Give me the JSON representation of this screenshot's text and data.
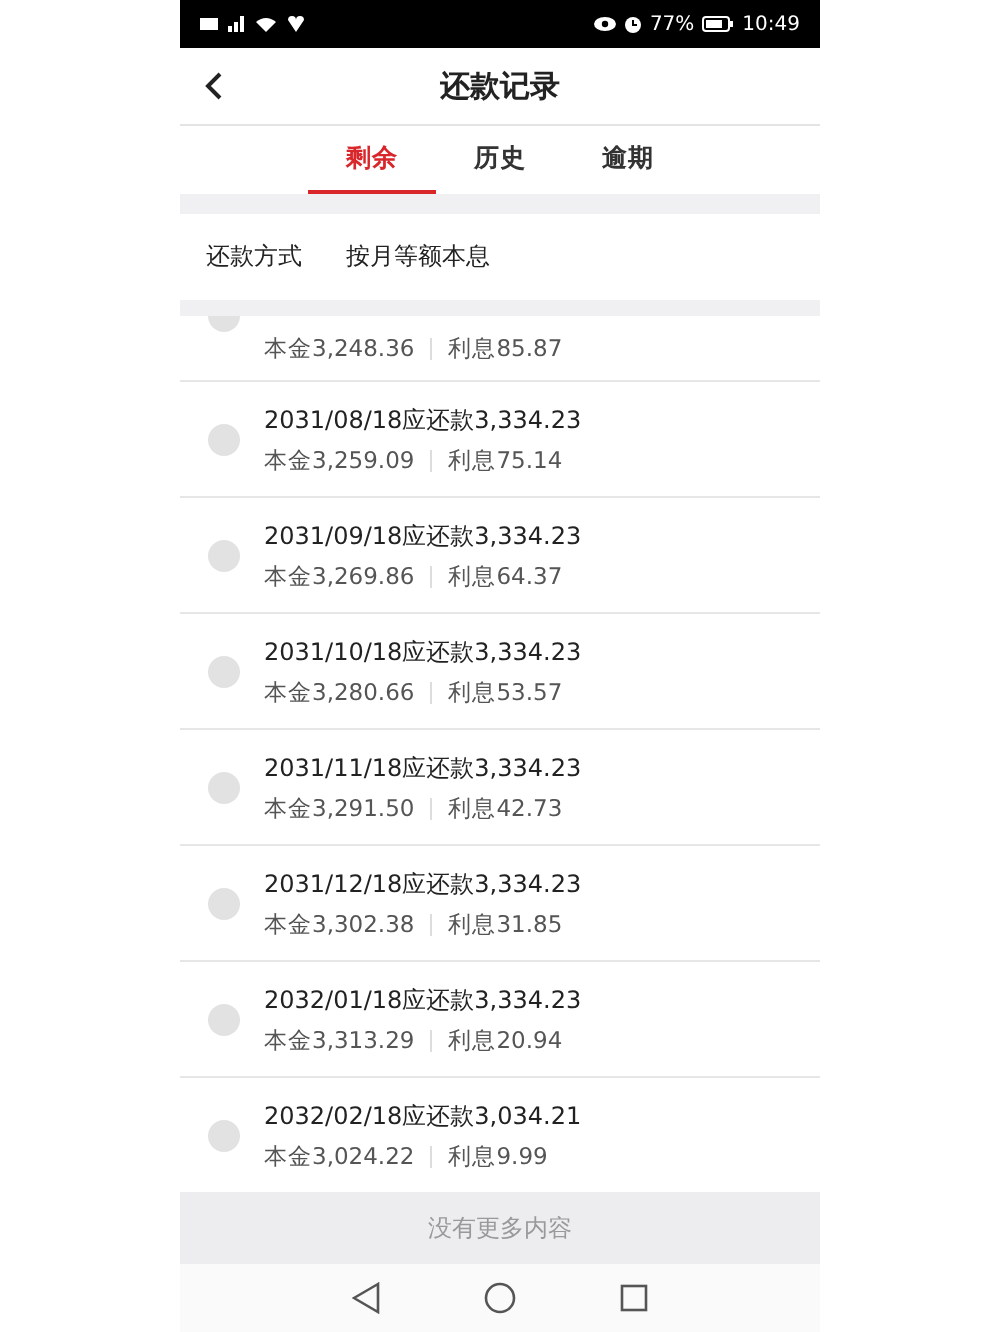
{
  "status_bar": {
    "battery": "77%",
    "time": "10:49"
  },
  "header": {
    "title": "还款记录"
  },
  "tabs": [
    {
      "label": "剩余",
      "selected": true
    },
    {
      "label": "历史",
      "selected": false
    },
    {
      "label": "逾期",
      "selected": false
    }
  ],
  "repayment_method": {
    "label": "还款方式",
    "value": "按月等额本息"
  },
  "installments": [
    {
      "principal": "本金3,248.36",
      "interest": "利息85.87"
    },
    {
      "title": "2031/08/18应还款3,334.23",
      "principal": "本金3,259.09",
      "interest": "利息75.14"
    },
    {
      "title": "2031/09/18应还款3,334.23",
      "principal": "本金3,269.86",
      "interest": "利息64.37"
    },
    {
      "title": "2031/10/18应还款3,334.23",
      "principal": "本金3,280.66",
      "interest": "利息53.57"
    },
    {
      "title": "2031/11/18应还款3,334.23",
      "principal": "本金3,291.50",
      "interest": "利息42.73"
    },
    {
      "title": "2031/12/18应还款3,334.23",
      "principal": "本金3,302.38",
      "interest": "利息31.85"
    },
    {
      "title": "2032/01/18应还款3,334.23",
      "principal": "本金3,313.29",
      "interest": "利息20.94"
    },
    {
      "title": "2032/02/18应还款3,034.21",
      "principal": "本金3,024.22",
      "interest": "利息9.99"
    }
  ],
  "footer": {
    "text": "没有更多内容"
  }
}
